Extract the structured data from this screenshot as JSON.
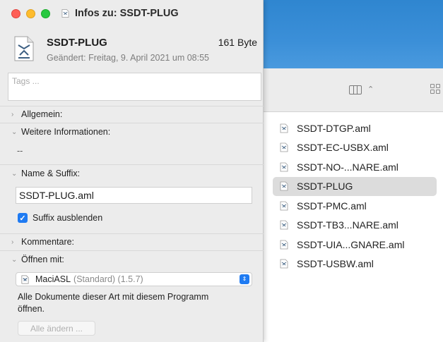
{
  "window": {
    "title": "Infos zu: SSDT-PLUG"
  },
  "header": {
    "file_name": "SSDT-PLUG",
    "file_size": "161 Byte",
    "modified": "Geändert: Freitag, 9. April 2021 um 08:55"
  },
  "tags": {
    "placeholder": "Tags ..."
  },
  "sections": {
    "general": {
      "label": "Allgemein:",
      "expanded": false
    },
    "more_info": {
      "label": "Weitere Informationen:",
      "expanded": true,
      "value": "--"
    },
    "name_suffix": {
      "label": "Name & Suffix:",
      "expanded": true,
      "name_value": "SSDT-PLUG.aml",
      "hide_suffix_label": "Suffix ausblenden",
      "hide_suffix_checked": true
    },
    "comments": {
      "label": "Kommentare:",
      "expanded": false
    },
    "open_with": {
      "label": "Öffnen mit:",
      "expanded": true,
      "app_name": "MaciASL",
      "app_detail": "(Standard) (1.5.7)",
      "description": "Alle Dokumente dieser Art mit diesem Programm öffnen.",
      "change_all_label": "Alle ändern ..."
    }
  },
  "finder": {
    "files": [
      {
        "name": "SSDT-DTGP.aml",
        "selected": false
      },
      {
        "name": "SSDT-EC-USBX.aml",
        "selected": false
      },
      {
        "name": "SSDT-NO-...NARE.aml",
        "selected": false
      },
      {
        "name": "SSDT-PLUG",
        "selected": true
      },
      {
        "name": "SSDT-PMC.aml",
        "selected": false
      },
      {
        "name": "SSDT-TB3...NARE.aml",
        "selected": false
      },
      {
        "name": "SSDT-UIA...GNARE.aml",
        "selected": false
      },
      {
        "name": "SSDT-USBW.aml",
        "selected": false
      }
    ]
  },
  "colors": {
    "accent": "#1f7bf2",
    "close": "#fe5f57",
    "minimize": "#febc2e",
    "zoom": "#28c840"
  }
}
